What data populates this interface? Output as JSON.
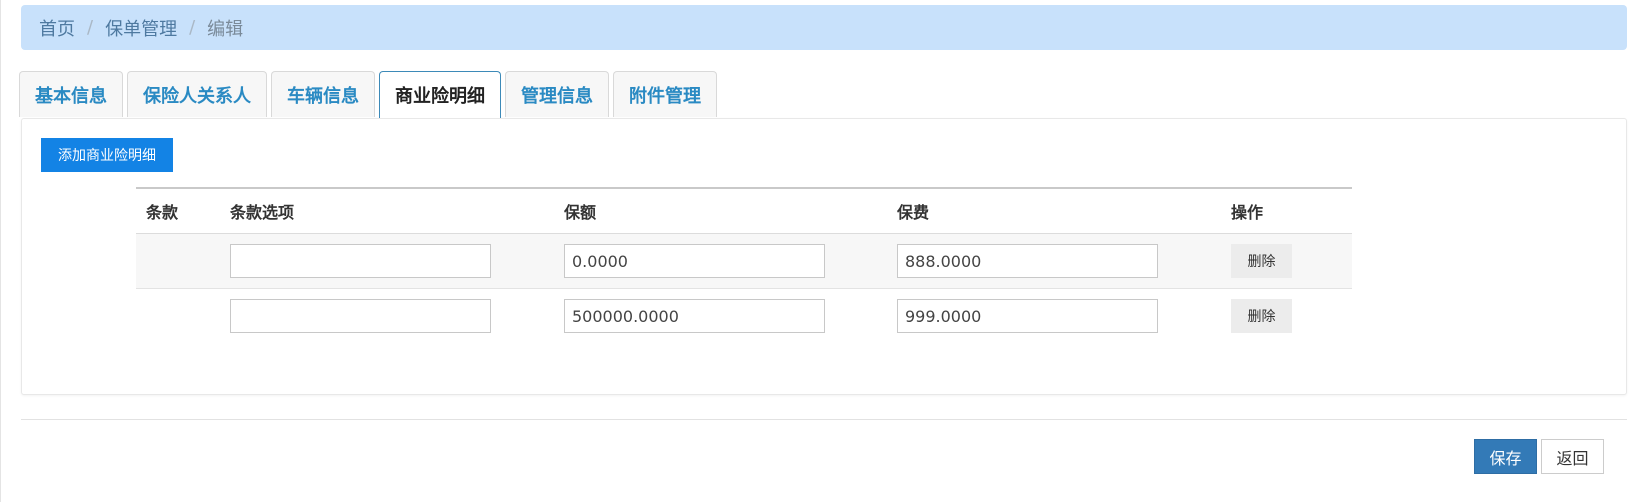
{
  "breadcrumb": {
    "home": "首页",
    "section": "保单管理",
    "current": "编辑",
    "separator": "/"
  },
  "tabs": [
    {
      "label": "基本信息",
      "active": false
    },
    {
      "label": "保险人关系人",
      "active": false
    },
    {
      "label": "车辆信息",
      "active": false
    },
    {
      "label": "商业险明细",
      "active": true
    },
    {
      "label": "管理信息",
      "active": false
    },
    {
      "label": "附件管理",
      "active": false
    }
  ],
  "panel": {
    "add_button": "添加商业险明细",
    "columns": [
      "条款",
      "条款选项",
      "保额",
      "保费",
      "操作"
    ],
    "rows": [
      {
        "clause": "",
        "option": "",
        "amount": "0.0000",
        "premium": "888.0000",
        "action": "删除"
      },
      {
        "clause": "",
        "option": "",
        "amount": "500000.0000",
        "premium": "999.0000",
        "action": "删除"
      }
    ]
  },
  "footer": {
    "save": "保存",
    "back": "返回"
  },
  "colors": {
    "breadcrumb_bg": "#c8e1fb",
    "tab_text": "#2a8ac3",
    "primary_button": "#1383e5",
    "save_button": "#337ab7"
  }
}
